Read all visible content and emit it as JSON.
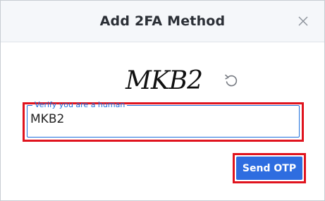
{
  "dialog": {
    "title": "Add 2FA Method"
  },
  "captcha": {
    "text": "MKB2",
    "icons": {
      "refresh": "refresh-icon",
      "close": "close-icon"
    }
  },
  "verify_field": {
    "label": "Verify you are a human",
    "value": "MKB2"
  },
  "actions": {
    "send_label": "Send OTP"
  },
  "colors": {
    "accent": "#2e6de0",
    "highlight": "#e0141e",
    "field_border": "#1f6fdc"
  }
}
